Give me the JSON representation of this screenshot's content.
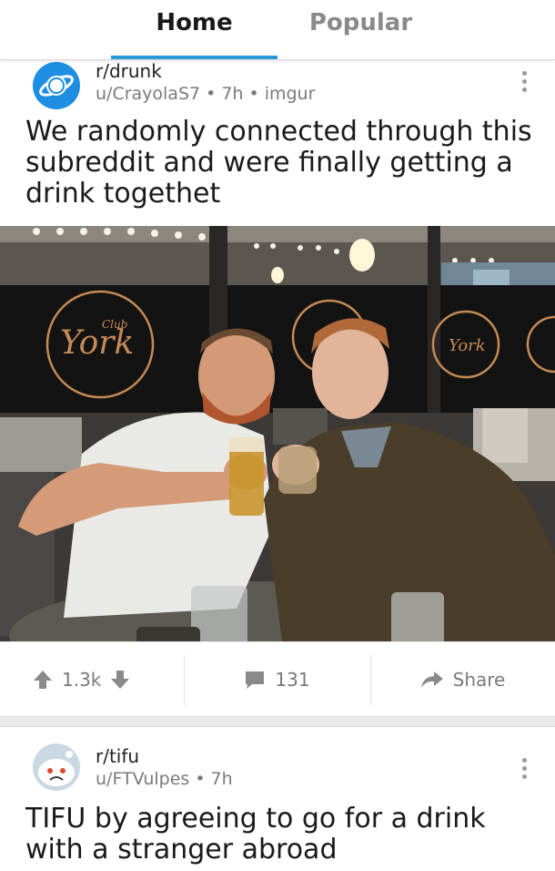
{
  "tabs": {
    "home": "Home",
    "popular": "Popular"
  },
  "colors": {
    "accent": "#2b9ad9",
    "drunk_avatar": "#1e8ee2",
    "muted": "#7a7a7a"
  },
  "posts": [
    {
      "subreddit": "r/drunk",
      "user": "u/CrayolaS7",
      "sep1": "•",
      "age": "7h",
      "sep2": "•",
      "domain": "imgur",
      "title": "We randomly connected through this subreddit and were finally getting a drink togethet",
      "photo_sign_text": "York",
      "photo_sign_small": "Club",
      "votes": "1.3k",
      "comments": "131",
      "share_label": "Share",
      "icons": [
        "upvote-icon",
        "downvote-icon",
        "comment-icon",
        "share-icon",
        "more-icon"
      ]
    },
    {
      "subreddit": "r/tifu",
      "user": "u/FTVulpes",
      "sep1": "•",
      "age": "7h",
      "title": "TIFU by agreeing to go for a drink with a stranger abroad"
    }
  ]
}
